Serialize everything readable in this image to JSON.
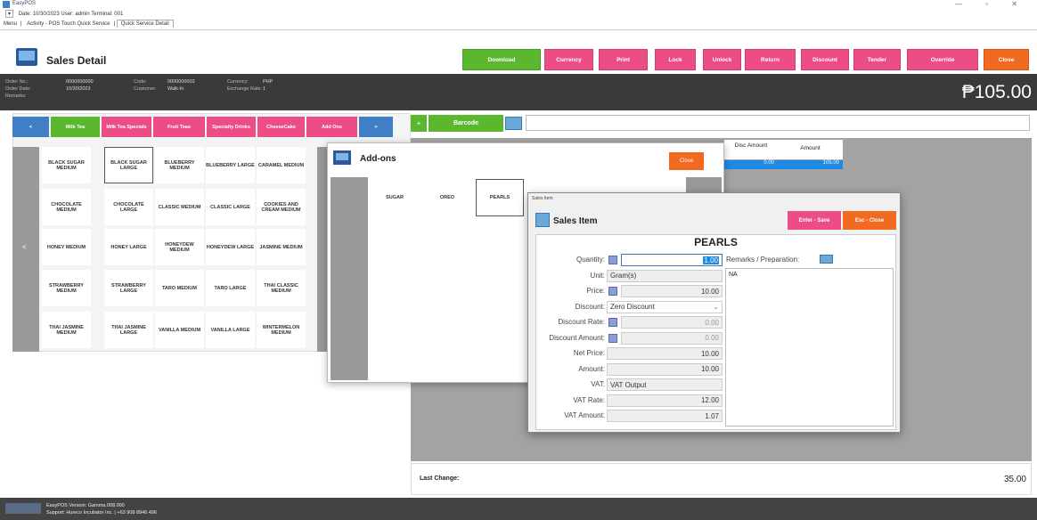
{
  "app": {
    "title": "EasyPOS"
  },
  "info": {
    "text": "Date: 10/30/2023   User: admin   Terminal: 001"
  },
  "tabs": [
    "Menu",
    "Activity - POS Touch Quick Service",
    "Quick Service Detail"
  ],
  "header": {
    "title": "Sales Detail"
  },
  "buttons": [
    {
      "label": "Download",
      "color": "#5bb82e"
    },
    {
      "label": "Currency",
      "color": "#ec4d87"
    },
    {
      "label": "Print",
      "color": "#ec4d87"
    },
    {
      "label": "Lock",
      "color": "#ec4d87"
    },
    {
      "label": "Unlock",
      "color": "#ec4d87"
    },
    {
      "label": "Return",
      "color": "#ec4d87"
    },
    {
      "label": "Discount",
      "color": "#ec4d87"
    },
    {
      "label": "Tender",
      "color": "#ec4d87"
    },
    {
      "label": "Override",
      "color": "#ec4d87"
    },
    {
      "label": "Close",
      "color": "#f26a1f"
    }
  ],
  "order": {
    "order_no_label": "Order No.:",
    "order_no": "0000000000",
    "order_date_label": "Order Date:",
    "order_date": "10/30/2023",
    "remarks_label": "Remarks:",
    "code_label": "Code:",
    "code": "0000000003",
    "customer_label": "Customer:",
    "customer": "Walk-In",
    "currency_label": "Currency:",
    "currency": "PHP",
    "exchange_label": "Exchange Rate:",
    "exchange": "1",
    "total": "₱105.00"
  },
  "categories": [
    {
      "label": "<",
      "color": "#3f7fc6"
    },
    {
      "label": "Milk Tea",
      "color": "#5bb82e"
    },
    {
      "label": "Milk Tea Specials",
      "color": "#ec4d87"
    },
    {
      "label": "Fruit Teas",
      "color": "#ec4d87"
    },
    {
      "label": "Specialty Drinks",
      "color": "#ec4d87"
    },
    {
      "label": "CheeseCake",
      "color": "#ec4d87"
    },
    {
      "label": "Add Ons",
      "color": "#ec4d87"
    },
    {
      "label": ">",
      "color": "#3f7fc6"
    }
  ],
  "items": [
    [
      "BLACK SUGAR MEDIUM",
      "BLACK SUGAR LARGE",
      "BLUEBERRY MEDIUM",
      "BLUEBERRY LARGE",
      "CARAMEL MEDIUM"
    ],
    [
      "CHOCOLATE MEDIUM",
      "CHOCOLATE LARGE",
      "CLASSIC MEDIUM",
      "CLASSIC LARGE",
      "COOKIES AND CREAM MEDIUM"
    ],
    [
      "HONEY MEDIUM",
      "HONEY LARGE",
      "HONEYDEW MEDIUM",
      "HONEYDEW LARGE",
      "JASMINE MEDIUM"
    ],
    [
      "STRAWBERRY MEDIUM",
      "STRAWBERRY LARGE",
      "TARO MEDIUM",
      "TARO LARGE",
      "THAI CLASSIC MEDIUM"
    ],
    [
      "THAI JASMINE MEDIUM",
      "THAI JASMINE LARGE",
      "VANILLA MEDIUM",
      "VANILLA LARGE",
      "WINTERMELON MEDIUM"
    ]
  ],
  "barcode": {
    "btn": "Barcode",
    "plus": "+",
    "value": ""
  },
  "grid": {
    "disc_amount_header": "Disc Amount",
    "amount_header": "Amount",
    "disc_amount": "0.00",
    "amount": "105.00"
  },
  "last_change": {
    "label": "Last Change:",
    "value": "35.00"
  },
  "addons": {
    "title": "Add-ons",
    "close": "Close",
    "items": [
      "SUGAR",
      "OREO",
      "PEARLS"
    ]
  },
  "sales_item": {
    "window_title": "Sales Item",
    "title": "Sales Item",
    "save": "Enter - Save",
    "close": "Esc - Close",
    "name": "PEARLS",
    "quantity_label": "Quantity:",
    "quantity": "1.00",
    "remarks_label": "Remarks / Preparation:",
    "remarks": "NA",
    "unit_label": "Unit:",
    "unit": "Gram(s)",
    "price_label": "Price:",
    "price": "10.00",
    "discount_label": "Discount:",
    "discount": "Zero Discount",
    "discount_rate_label": "Discount Rate:",
    "discount_rate": "0.00",
    "discount_amount_label": "Discount Amount:",
    "discount_amount": "0.00",
    "net_price_label": "Net Price:",
    "net_price": "10.00",
    "amount_label": "Amount:",
    "amount": "10.00",
    "vat_label": "VAT:",
    "vat": "VAT Output",
    "vat_rate_label": "VAT Rate:",
    "vat_rate": "12.00",
    "vat_amount_label": "VAT Amount:",
    "vat_amount": "1.07"
  },
  "status": {
    "version": "EasyPOS Version: Gamma.008.000",
    "support": "Support: Hureco Incubator Inc. | +63 908 8946 496"
  }
}
